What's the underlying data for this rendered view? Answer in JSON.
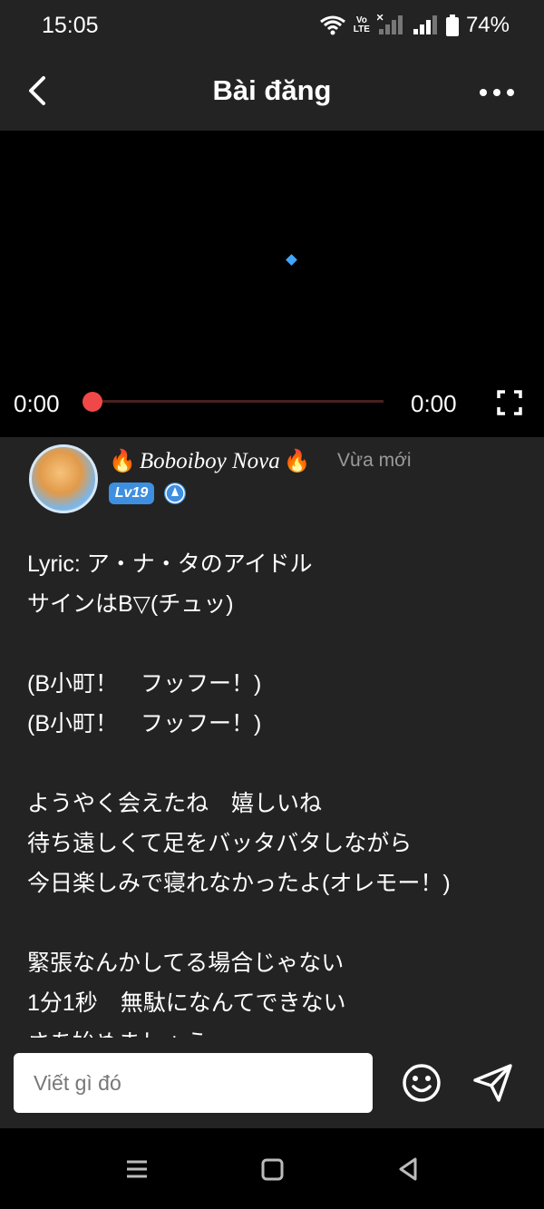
{
  "status_bar": {
    "time": "15:05",
    "volte_label_top": "Vo",
    "volte_label_bottom": "LTE",
    "battery_percent": "74%"
  },
  "app_bar": {
    "title": "Bài đăng",
    "back_icon": "chevron-left-icon",
    "more_icon": "more-horizontal-icon"
  },
  "video_player": {
    "current_time": "0:00",
    "duration": "0:00",
    "progress": 0
  },
  "post": {
    "author_name": "Boboiboy Nova",
    "author_prefix_emoji": "🔥",
    "author_suffix_emoji": "🔥",
    "timestamp": "Vừa mới",
    "level": "Lv19",
    "lyrics": "Lyric: ア・ナ・タのアイドル\nサインはB▽(チュッ)\n\n(B小町！　フッフー！)\n(B小町！　フッフー！)\n\nようやく会えたね　嬉しいね\n待ち遠しくて足をバッタバタしながら\n今日楽しみで寝れなかったよ(オレモー！)\n\n緊張なんかしてる場合じゃない\n1分1秒　無駄になんてできない\nさあ始めましょう"
  },
  "composer": {
    "placeholder": "Viết gì đó"
  },
  "colors": {
    "background": "#232323",
    "accent_red": "#f04848",
    "level_blue": "#3e8fe0"
  }
}
